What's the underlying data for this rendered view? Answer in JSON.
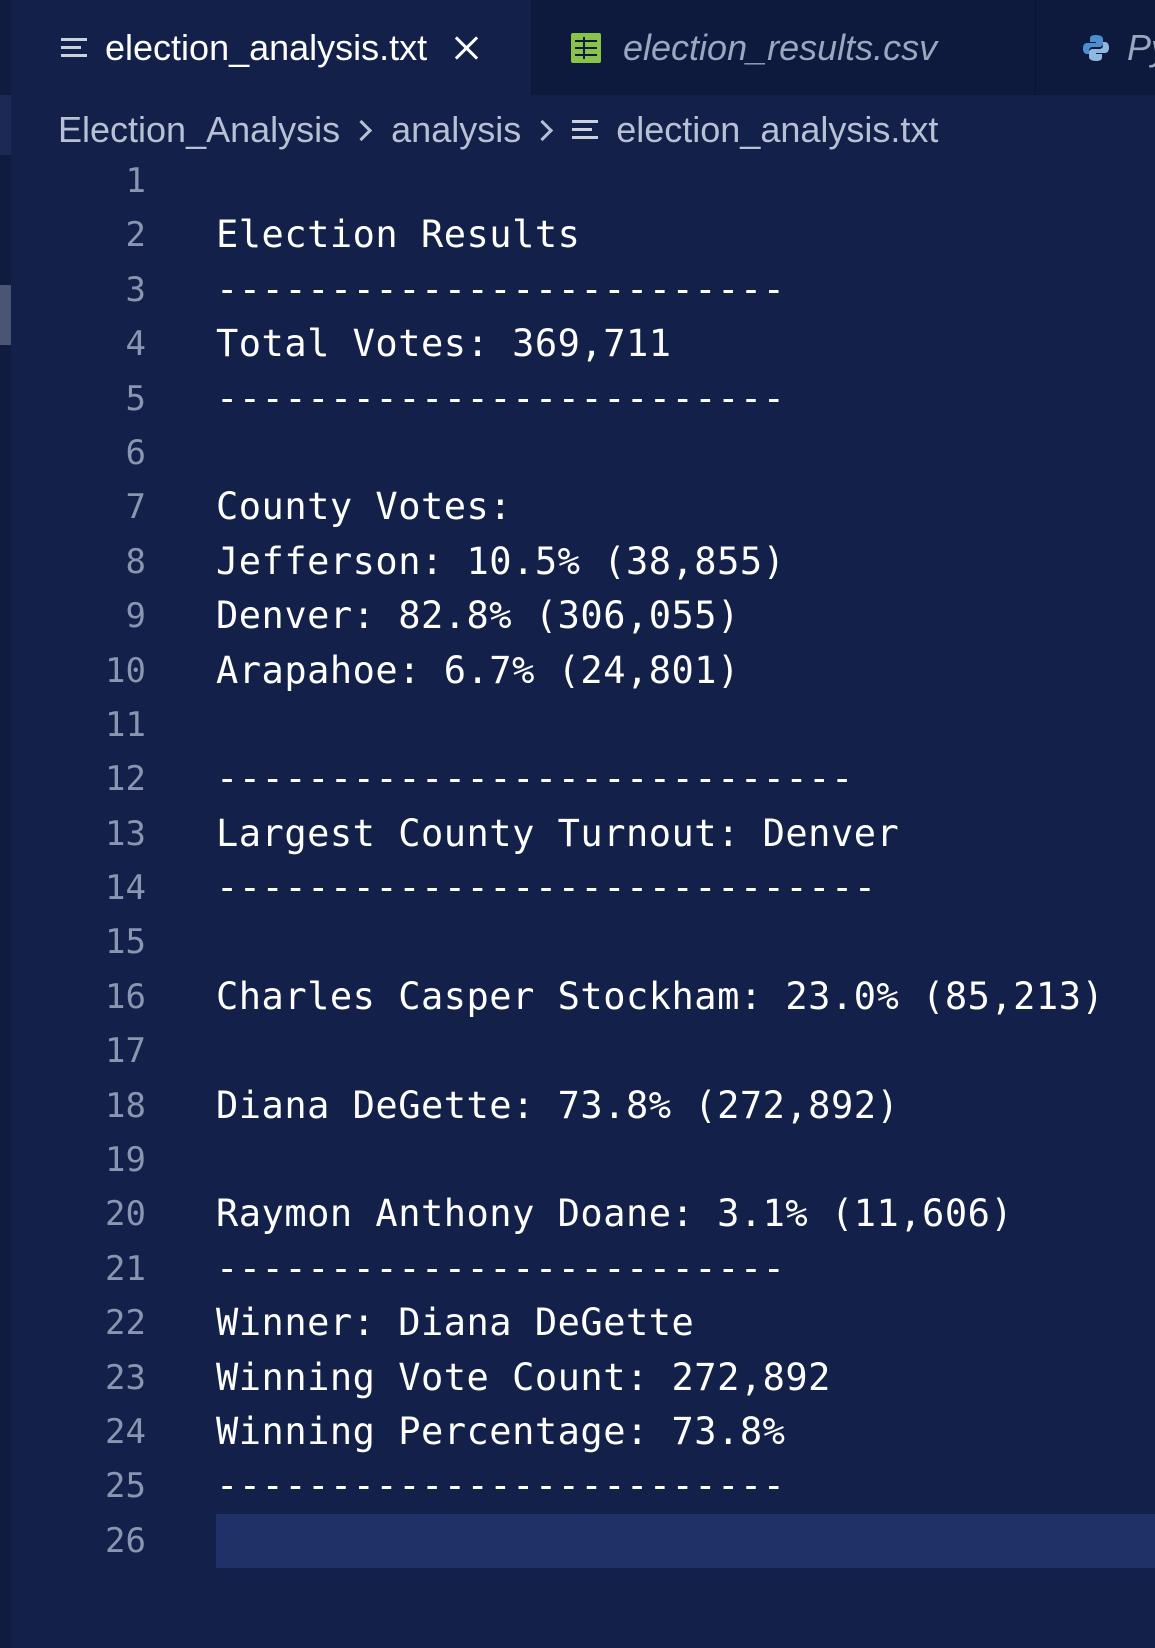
{
  "tabs": [
    {
      "label": "election_analysis.txt",
      "icon": "text-file-icon",
      "active": true
    },
    {
      "label": "election_results.csv",
      "icon": "csv-file-icon",
      "active": false
    },
    {
      "label": "Py",
      "icon": "python-file-icon",
      "active": false
    }
  ],
  "breadcrumb": {
    "folder1": "Election_Analysis",
    "folder2": "analysis",
    "file": "election_analysis.txt"
  },
  "editor": {
    "current_line": 26,
    "lines": [
      {
        "n": "1",
        "text": ""
      },
      {
        "n": "2",
        "text": "Election Results"
      },
      {
        "n": "3",
        "text": "-------------------------"
      },
      {
        "n": "4",
        "text": "Total Votes: 369,711"
      },
      {
        "n": "5",
        "text": "-------------------------"
      },
      {
        "n": "6",
        "text": ""
      },
      {
        "n": "7",
        "text": "County Votes:"
      },
      {
        "n": "8",
        "text": "Jefferson: 10.5% (38,855)"
      },
      {
        "n": "9",
        "text": "Denver: 82.8% (306,055)"
      },
      {
        "n": "10",
        "text": "Arapahoe: 6.7% (24,801)"
      },
      {
        "n": "11",
        "text": ""
      },
      {
        "n": "12",
        "text": "----------------------------"
      },
      {
        "n": "13",
        "text": "Largest County Turnout: Denver"
      },
      {
        "n": "14",
        "text": "-----------------------------"
      },
      {
        "n": "15",
        "text": ""
      },
      {
        "n": "16",
        "text": "Charles Casper Stockham: 23.0% (85,213)"
      },
      {
        "n": "17",
        "text": ""
      },
      {
        "n": "18",
        "text": "Diana DeGette: 73.8% (272,892)"
      },
      {
        "n": "19",
        "text": ""
      },
      {
        "n": "20",
        "text": "Raymon Anthony Doane: 3.1% (11,606)"
      },
      {
        "n": "21",
        "text": "-------------------------"
      },
      {
        "n": "22",
        "text": "Winner: Diana DeGette"
      },
      {
        "n": "23",
        "text": "Winning Vote Count: 272,892"
      },
      {
        "n": "24",
        "text": "Winning Percentage: 73.8%"
      },
      {
        "n": "25",
        "text": "-------------------------"
      },
      {
        "n": "26",
        "text": ""
      }
    ]
  }
}
